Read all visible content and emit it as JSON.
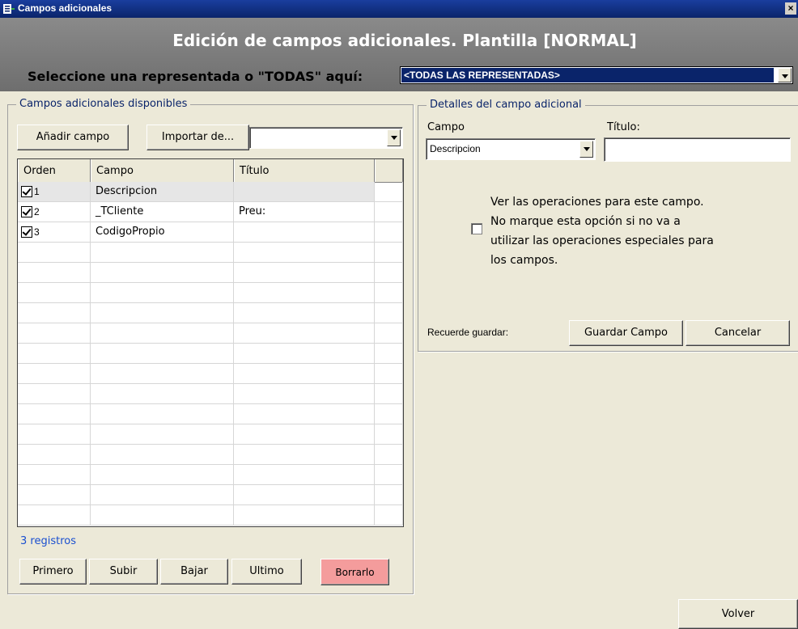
{
  "window": {
    "title": "Campos adicionales",
    "close_glyph": "×"
  },
  "header": {
    "heading": "Edición de campos adicionales. Plantilla [NORMAL]",
    "select_label": "Seleccione una representada o \"TODAS\" aquí:",
    "representada_value": "<TODAS LAS REPRESENTADAS>"
  },
  "left": {
    "legend": "Campos adicionales disponibles",
    "add_button": "Añadir campo",
    "import_button": "Importar de...",
    "import_value": "",
    "columns": [
      "Orden",
      "Campo",
      "Título"
    ],
    "rows": [
      {
        "orden": "1",
        "campo": "Descripcion",
        "titulo": "",
        "checked": true
      },
      {
        "orden": "2",
        "campo": "_TCliente",
        "titulo": "Preu:",
        "checked": true
      },
      {
        "orden": "3",
        "campo": "CodigoPropio",
        "titulo": "",
        "checked": true
      }
    ],
    "record_count": "3 registros",
    "buttons": {
      "first": "Primero",
      "up": "Subir",
      "down": "Bajar",
      "last": "Ultimo",
      "delete": "Borrarlo"
    }
  },
  "right": {
    "legend": "Detalles del campo adicional",
    "campo_label": "Campo",
    "campo_value": "Descripcion",
    "titulo_label": "Título:",
    "titulo_value": "",
    "operations_text": [
      "Ver las operaciones para este campo.",
      "No marque esta opción si no va a",
      "utilizar las operaciones especiales para",
      "los campos."
    ],
    "operations_checked": false,
    "remember_label": "Recuerde guardar:",
    "save_button": "Guardar Campo",
    "cancel_button": "Cancelar"
  },
  "footer": {
    "back_button": "Volver"
  },
  "colors": {
    "titlebar": "#0a246a",
    "header": "#7a7a7a",
    "panel": "#ece9d8",
    "delete_button": "#f49c9c",
    "legend_text": "#0a246a"
  }
}
